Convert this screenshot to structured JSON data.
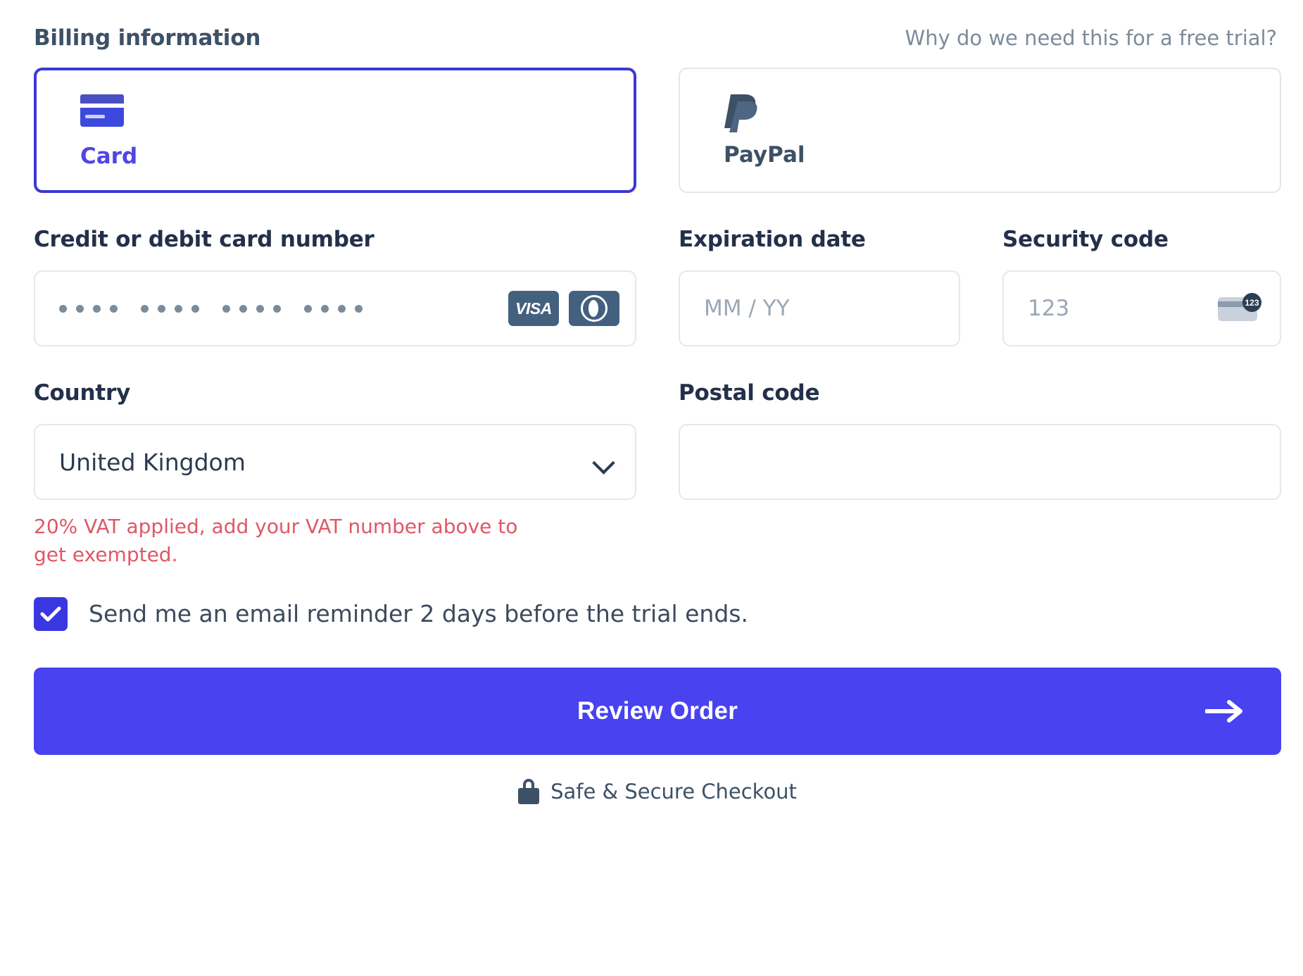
{
  "header": {
    "title": "Billing information",
    "why_link": "Why do we need this for a free trial?"
  },
  "payment_methods": [
    {
      "label": "Card",
      "icon": "credit-card-icon",
      "selected": true
    },
    {
      "label": "PayPal",
      "icon": "paypal-icon",
      "selected": false
    }
  ],
  "fields": {
    "card_number": {
      "label": "Credit or debit card number",
      "value_masked": "•••• •••• •••• ••••",
      "mask_digits": 16,
      "brands": [
        {
          "name": "visa-icon",
          "text": "VISA"
        },
        {
          "name": "diners-club-icon",
          "text": ""
        }
      ]
    },
    "expiration": {
      "label": "Expiration date",
      "placeholder": "MM / YY",
      "value": ""
    },
    "security_code": {
      "label": "Security code",
      "placeholder": "123",
      "value": "",
      "icon": "cvv-card-icon",
      "icon_badge": "123"
    },
    "country": {
      "label": "Country",
      "selected": "United Kingdom",
      "options": [
        "United Kingdom"
      ],
      "note": "20% VAT applied, add your VAT number above to get exempted.",
      "note_color": "#e05766"
    },
    "postal_code": {
      "label": "Postal code",
      "placeholder": "",
      "value": ""
    }
  },
  "reminder": {
    "checked": true,
    "label": "Send me an email reminder 2 days before the trial ends."
  },
  "submit": {
    "label": "Review Order",
    "icon": "arrow-right-icon",
    "color": "#4842f0"
  },
  "footer": {
    "text": "Safe & Secure Checkout",
    "icon": "lock-icon"
  },
  "colors": {
    "accent": "#4842f0",
    "selected_border": "#3b37d6",
    "label": "#23304a",
    "muted": "#7c8b9c",
    "error": "#e05766",
    "brand_badge": "#44607f"
  }
}
